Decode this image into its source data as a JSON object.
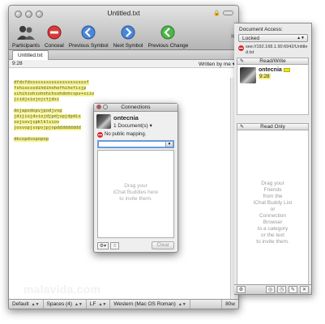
{
  "window": {
    "title": "Untitled.txt"
  },
  "toolbar": {
    "participants": "Participants",
    "conceal": "Conceal",
    "previous_symbol": "Previous Symbol",
    "next_symbol": "Next Symbol",
    "previous_change": "Previous Change"
  },
  "tab": {
    "label": "Untitled.txt"
  },
  "infobar": {
    "position": "9:28",
    "written_by": "Written by me"
  },
  "editor": {
    "lines": [
      "dfdsfdsssssssssssssssssssssf",
      "fshiocssdihdihohofhihofisjp",
      "sihihiohiohohihsohdohcspv+siio",
      "jcidjsiojojctjdsi",
      "",
      "dojapodopvjpodjvop",
      "jdijiojdviojdjpdjvpjdpdis",
      "sojsovjspklklsiov",
      "josvopjsopvjpjopddddddddd",
      "",
      "dkcopdsopopop"
    ]
  },
  "statusbar": {
    "line_ending_mode": "Default",
    "indent": "Spaces (4)",
    "line_ending": "LF",
    "encoding": "Western (Mac OS Roman)",
    "wrap": "80w"
  },
  "watermark": "malavida.com",
  "drawer": {
    "access_label": "Document Access:",
    "access_value": "Locked",
    "url": "see://192.168.1.90:6942/Untitled.txt",
    "read_write_label": "Read/Write",
    "read_only_label": "Read Only",
    "user": {
      "name": "ontecnia",
      "time": "9:28"
    },
    "hint_lines": [
      "Drag your",
      "Friends",
      "from the",
      "iChat Buddy List",
      "or",
      "Connection",
      "Browser",
      "to a category",
      "or the text",
      "to invite them."
    ]
  },
  "connections": {
    "title": "Connections",
    "user": "ontecnia",
    "documents": "1 Document(s)",
    "mapping": "No public mapping.",
    "hint_lines": [
      "Drag your",
      "iChat Buddies here",
      "to invite them."
    ],
    "clear_label": "Clear"
  },
  "colors": {
    "highlight": "#f6f384",
    "user_color": "#e8e620",
    "focus_ring": "#6a9ae0",
    "alert": "#d92b2b"
  }
}
